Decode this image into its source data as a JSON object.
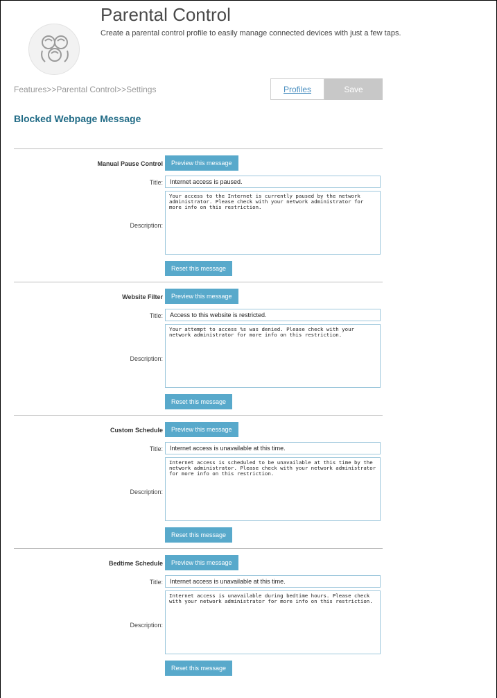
{
  "header": {
    "title": "Parental Control",
    "subtitle": "Create a parental control profile to easily manage connected devices with just a few taps."
  },
  "breadcrumb": "Features>>Parental Control>>Settings",
  "toolbar": {
    "profiles_label": "Profiles",
    "save_label": "Save"
  },
  "section_heading": "Blocked Webpage Message",
  "labels": {
    "title": "Title:",
    "description": "Description:",
    "preview": "Preview this message",
    "reset": "Reset this message"
  },
  "messages": [
    {
      "name": "Manual Pause Control",
      "title": "Internet access is paused.",
      "description": "Your access to the Internet is currently paused by the network administrator. Please check with your network administrator for more info on this restriction."
    },
    {
      "name": "Website Filter",
      "title": "Access to this website is restricted.",
      "description": "Your attempt to access %s was denied. Please check with your network administrator for more info on this restriction."
    },
    {
      "name": "Custom Schedule",
      "title": "Internet access is unavailable at this time.",
      "description": "Internet access is scheduled to be unavailable at this time by the network administrator. Please check with your network administrator for more info on this restriction."
    },
    {
      "name": "Bedtime Schedule",
      "title": "Internet access is unavailable at this time.",
      "description": "Internet access is unavailable during bedtime hours. Please check with your network administrator for more info on this restriction."
    }
  ],
  "colors": {
    "accent": "#58a9cb",
    "heading": "#1f6a85",
    "link": "#4a8fc0"
  },
  "icons": {
    "logo": "family-icon"
  }
}
